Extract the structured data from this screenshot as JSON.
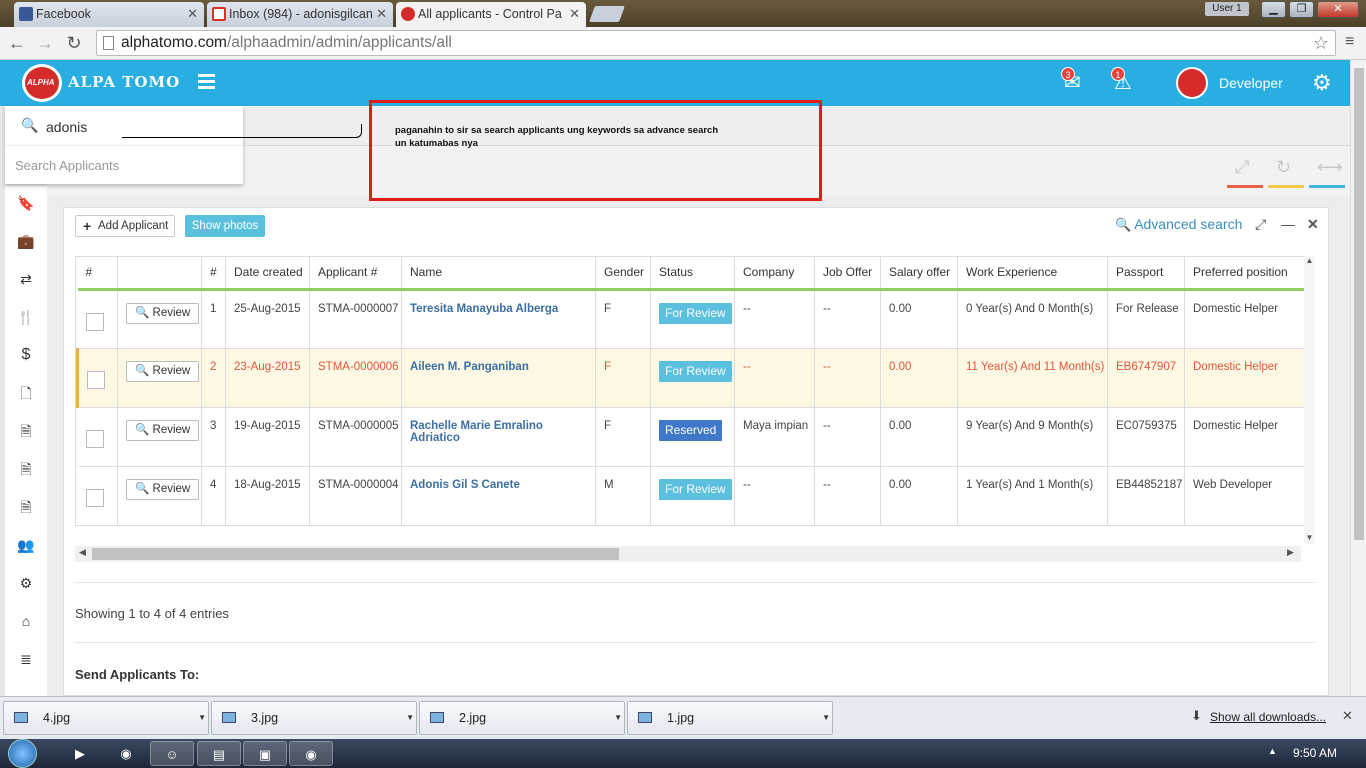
{
  "browser": {
    "tabs": [
      {
        "label": "Facebook",
        "color": "#3b5998"
      },
      {
        "label": "Inbox (984) - adonisgilcan",
        "color": "#d93025"
      },
      {
        "label": "All applicants - Control Pa",
        "color": "#d62b2b"
      }
    ],
    "window_user": "User 1",
    "url_host": "alphatomo.com",
    "url_path": "/alphaadmin/admin/applicants/all"
  },
  "header": {
    "brand": "ALPA TOMO",
    "messages_badge": "3",
    "alerts_badge": "1",
    "user_name": "Developer"
  },
  "search": {
    "value": "adonis",
    "placeholder": "Search Applicants"
  },
  "annotation": {
    "text": "paganahin to sir sa search applicants ung keywords sa advance search un katumabas nya"
  },
  "toolbar": {
    "add_label": "Add Applicant",
    "photos_label": "Show photos",
    "advanced_label": "Advanced search"
  },
  "table": {
    "columns": [
      "#",
      "",
      "#",
      "Date created",
      "Applicant #",
      "Name",
      "Gender",
      "Status",
      "Company",
      "Job Offer",
      "Salary offer",
      "Work Experience",
      "Passport",
      "Preferred position"
    ],
    "review_label": "Review",
    "rows": [
      {
        "num": "1",
        "date": "25-Aug-2015",
        "app": "STMA-0000007",
        "name": "Teresita Manayuba Alberga",
        "gender": "F",
        "status": "For Review",
        "company": "--",
        "job": "--",
        "salary": "0.00",
        "exp": "0 Year(s) And 0 Month(s)",
        "passport": "For Release",
        "position": "Domestic Helper"
      },
      {
        "num": "2",
        "date": "23-Aug-2015",
        "app": "STMA-0000006",
        "name": "Aileen M. Panganiban",
        "gender": "F",
        "status": "For Review",
        "company": "--",
        "job": "--",
        "salary": "0.00",
        "exp": "11 Year(s) And 11 Month(s)",
        "passport": "EB6747907",
        "position": "Domestic Helper"
      },
      {
        "num": "3",
        "date": "19-Aug-2015",
        "app": "STMA-0000005",
        "name": "Rachelle Marie Emralino Adriatico",
        "gender": "F",
        "status": "Reserved",
        "company": "Maya impian",
        "job": "--",
        "salary": "0.00",
        "exp": "9 Year(s) And 9 Month(s)",
        "passport": "EC0759375",
        "position": "Domestic Helper"
      },
      {
        "num": "4",
        "date": "18-Aug-2015",
        "app": "STMA-0000004",
        "name": "Adonis Gil S Canete",
        "gender": "M",
        "status": "For Review",
        "company": "--",
        "job": "--",
        "salary": "0.00",
        "exp": "1 Year(s) And 1 Month(s)",
        "passport": "EB44852187",
        "position": "Web Developer"
      }
    ]
  },
  "footer": {
    "showing": "Showing 1 to 4 of 4 entries",
    "send_to": "Send Applicants To:"
  },
  "downloads": {
    "items": [
      "4.jpg",
      "3.jpg",
      "2.jpg",
      "1.jpg"
    ],
    "show_all": "Show all downloads..."
  },
  "taskbar": {
    "clock": "9:50 AM"
  },
  "colors": {
    "header": "#29aee2",
    "annotation_border": "#e01b1b",
    "for_review": "#5bc0de",
    "reserved": "#3f78c8",
    "highlight_row": "#fcf8e3"
  }
}
